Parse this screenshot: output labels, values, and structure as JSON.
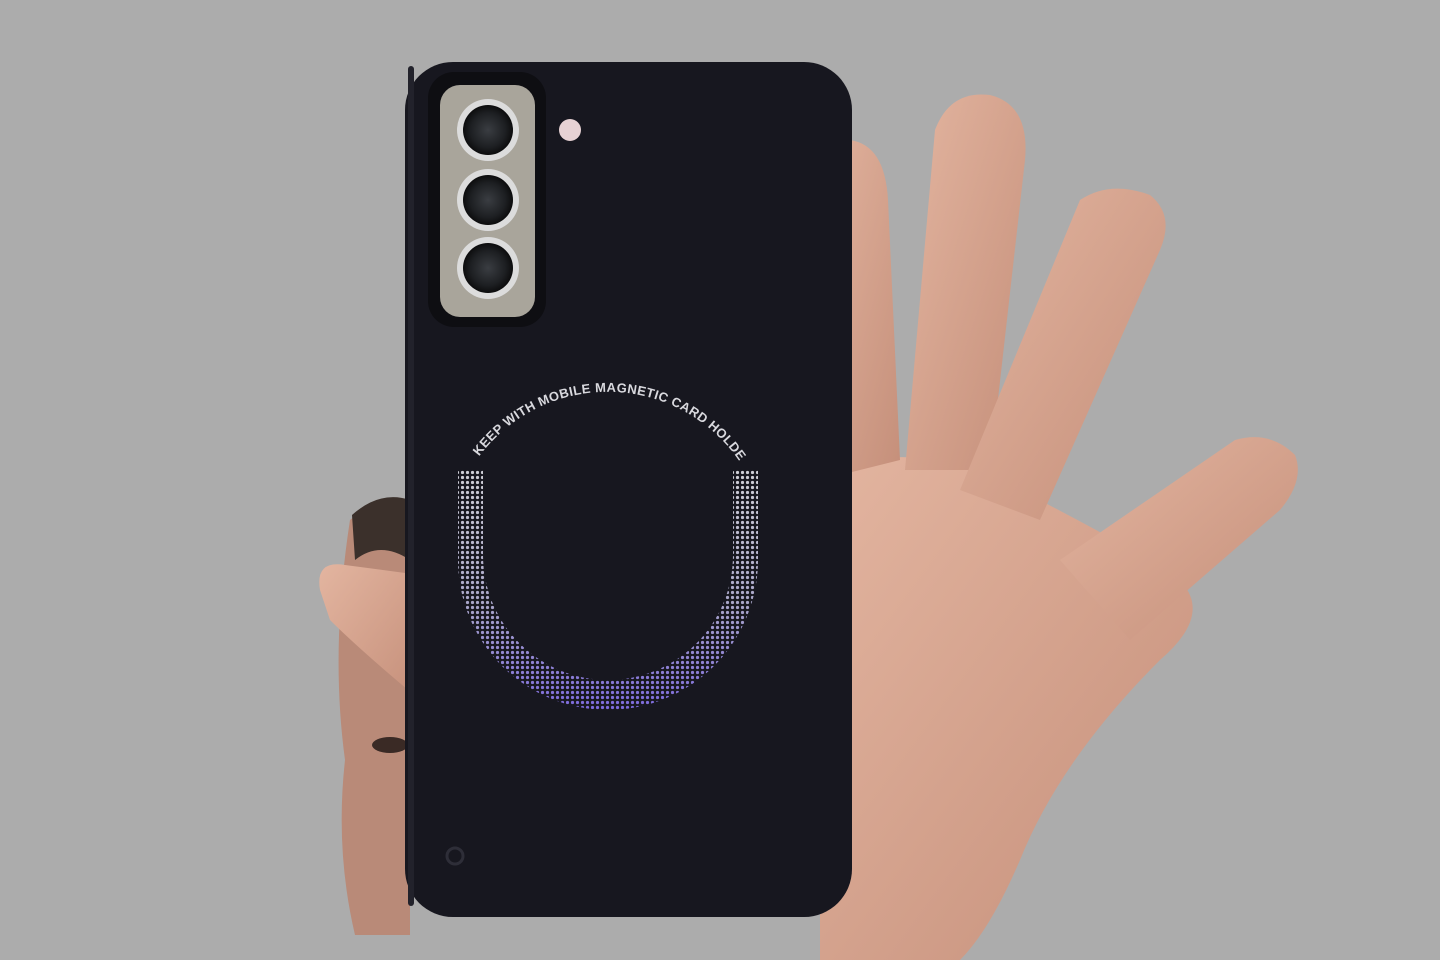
{
  "photo": {
    "subject": "phone-case-back",
    "case_print_text": "KEEP WITH MOBILE MAGNETIC CARD HOLDER",
    "colors": {
      "background": "#acacac",
      "case": "#17171f",
      "camera_module": "#a9a59b",
      "skin": "#d8a690",
      "ring_light": "#c9c9d2",
      "ring_accent": "#7f6fd6"
    }
  }
}
